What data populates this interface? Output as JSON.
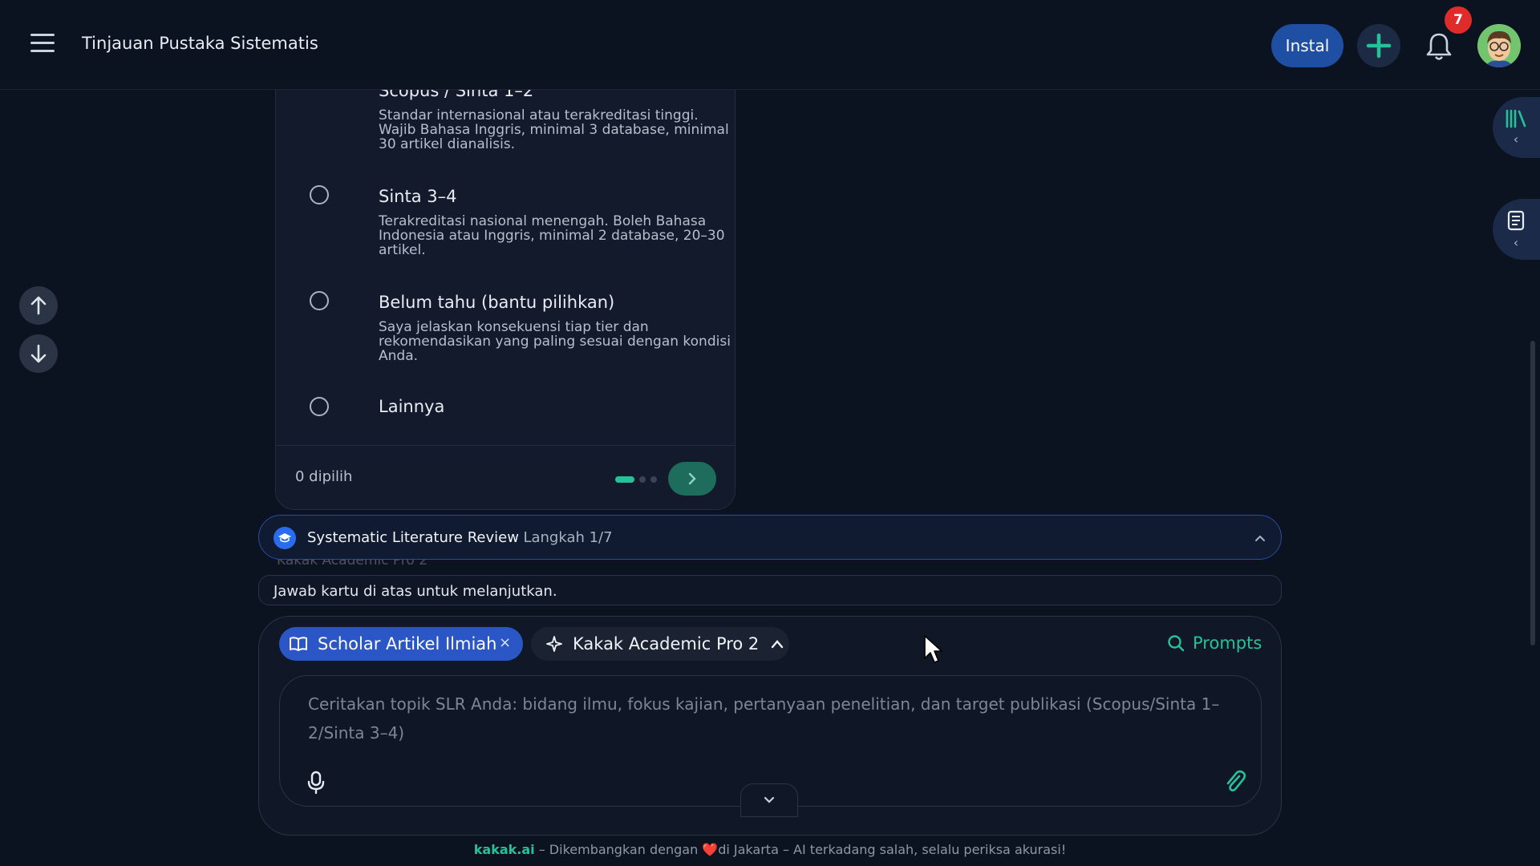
{
  "header": {
    "title": "Tinjauan Pustaka Sistematis",
    "install_label": "Instal",
    "notification_count": "7"
  },
  "card": {
    "options": [
      {
        "label": "Scopus / Sinta 1–2",
        "desc": "Standar internasional atau terakreditasi tinggi. Wajib Bahasa Inggris, minimal 3 database, minimal 30 artikel dianalisis."
      },
      {
        "label": "Sinta 3–4",
        "desc": "Terakreditasi nasional menengah. Boleh Bahasa Indonesia atau Inggris, minimal 2 database, 20–30 artikel."
      },
      {
        "label": "Belum tahu (bantu pilihkan)",
        "desc": "Saya jelaskan konsekuensi tiap tier dan rekomendasikan yang paling sesuai dengan kondisi Anda."
      },
      {
        "label": "Lainnya",
        "desc": ""
      }
    ],
    "selected_count": "0 dipilih",
    "page_dots": 3,
    "active_dot": 1
  },
  "stepbar": {
    "title": "Systematic Literature Review",
    "step": "· Langkah 1/7",
    "ghost_text": "Kakak Academic Pro 2"
  },
  "hint": "Jawab kartu di atas untuk melanjutkan.",
  "composer": {
    "scholar_chip": "Scholar Artikel Ilmiah",
    "model_chip": "Kakak Academic Pro 2",
    "prompts_label": "Prompts",
    "placeholder": "Ceritakan topik SLR Anda: bidang ilmu, fokus kajian, pertanyaan penelitian, dan target publikasi (Scopus/Sinta 1–2/Sinta 3–4)"
  },
  "footer": {
    "brand": "kakak.ai",
    "text_before": " – Dikembangkan dengan ",
    "heart": "❤️",
    "text_after": "di Jakarta – AI terkadang salah, selalu periksa akurasi!"
  },
  "colors": {
    "accent": "#25c29a",
    "primary": "#2a56c6",
    "badge": "#e02b2b",
    "background": "#0b1220"
  },
  "icons": [
    "menu-icon",
    "plus-icon",
    "bell-icon",
    "arrow-up-icon",
    "arrow-down-icon",
    "library-icon",
    "scroll-icon",
    "graduation-cap-icon",
    "book-open-icon",
    "sparkle-icon",
    "search-icon",
    "microphone-icon",
    "paperclip-icon",
    "chevron-down-icon"
  ]
}
